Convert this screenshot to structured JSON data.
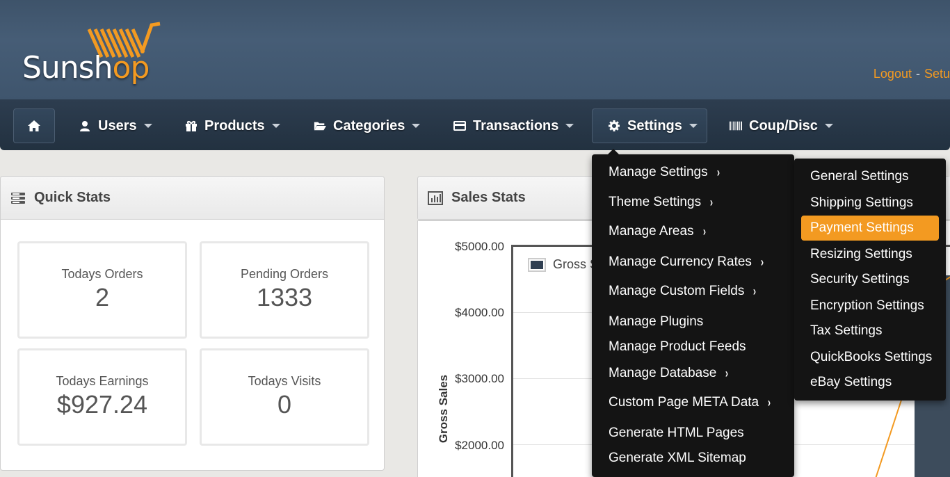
{
  "header": {
    "logo_text_a": "Suns",
    "logo_text_o": "h",
    "logo_text_b": "op",
    "links": [
      "Logout",
      "Setu"
    ],
    "link_separator": "-"
  },
  "nav": {
    "home_icon": "home-icon",
    "items": [
      {
        "label": "Users",
        "icon": "user-icon"
      },
      {
        "label": "Products",
        "icon": "gift-icon"
      },
      {
        "label": "Categories",
        "icon": "folder-icon"
      },
      {
        "label": "Transactions",
        "icon": "credit-card-icon"
      },
      {
        "label": "Settings",
        "icon": "gear-icon"
      },
      {
        "label": "Coup/Disc",
        "icon": "barcode-icon"
      }
    ]
  },
  "quick_stats": {
    "title": "Quick Stats",
    "boxes": [
      {
        "label": "Todays Orders",
        "value": "2"
      },
      {
        "label": "Pending Orders",
        "value": "1333"
      },
      {
        "label": "Todays Earnings",
        "value": "$927.24"
      },
      {
        "label": "Todays Visits",
        "value": "0"
      }
    ]
  },
  "sales_stats": {
    "title": "Sales Stats",
    "legend": "Gross Sa",
    "ylabel": "Gross Sales",
    "yticks": [
      "$5000.00",
      "$4000.00",
      "$3000.00",
      "$2000.00"
    ]
  },
  "settings_menu": {
    "items": [
      {
        "label": "Manage Settings",
        "has_sub": true
      },
      {
        "label": "Theme Settings",
        "has_sub": true
      },
      {
        "label": "Manage Areas",
        "has_sub": true
      },
      {
        "label": "Manage Currency Rates",
        "has_sub": true
      },
      {
        "label": "Manage Custom Fields",
        "has_sub": true
      },
      {
        "label": "Manage Plugins",
        "has_sub": false
      },
      {
        "label": "Manage Product Feeds",
        "has_sub": false
      },
      {
        "label": "Manage Database",
        "has_sub": true
      },
      {
        "label": "Custom Page META Data",
        "has_sub": true
      },
      {
        "label": "Generate HTML Pages",
        "has_sub": false
      },
      {
        "label": "Generate XML Sitemap",
        "has_sub": false
      }
    ],
    "chevron": "›"
  },
  "manage_settings_submenu": {
    "items": [
      {
        "label": "General Settings"
      },
      {
        "label": "Shipping Settings"
      },
      {
        "label": "Payment Settings",
        "active": true
      },
      {
        "label": "Resizing Settings"
      },
      {
        "label": "Security Settings"
      },
      {
        "label": "Encryption Settings"
      },
      {
        "label": "Tax Settings"
      },
      {
        "label": "QuickBooks Settings"
      },
      {
        "label": "eBay Settings"
      }
    ]
  },
  "colors": {
    "accent": "#f39a21",
    "header_bg": "#465d76",
    "nav_bg": "#2d3d4f",
    "menu_bg": "#141414"
  }
}
